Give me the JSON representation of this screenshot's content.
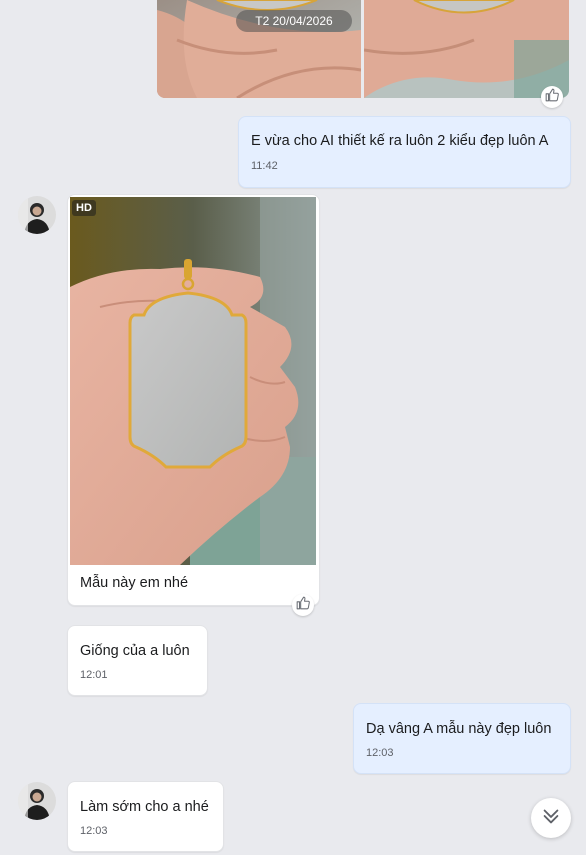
{
  "date_separator": "T2 20/04/2026",
  "messages": [
    {
      "text": "E vừa cho AI thiết kế ra luôn 2 kiểu đẹp luôn A",
      "time": "11:42"
    },
    {
      "text": "Mẫu này em nhé"
    },
    {
      "text": "Giống của a luôn",
      "time": "12:01"
    },
    {
      "text": "Dạ vâng A mẫu này đẹp luôn",
      "time": "12:03"
    },
    {
      "text": "Làm sớm cho a nhé",
      "time": "12:03"
    }
  ],
  "image_badge": "HD",
  "icons": {
    "like": "thumbs-up-icon",
    "scroll": "chevron-double-down-icon"
  }
}
